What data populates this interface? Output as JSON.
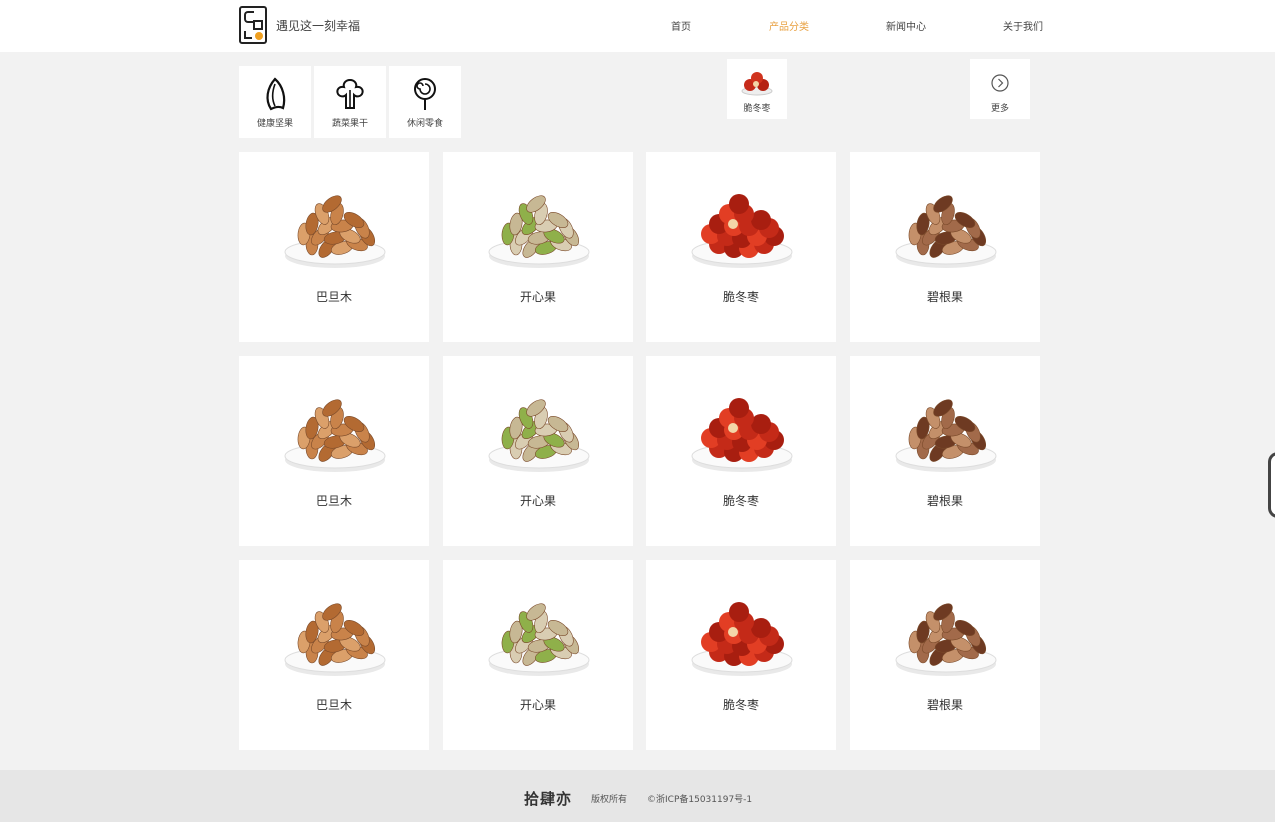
{
  "header": {
    "slogan": "遇见这一刻幸福",
    "nav": [
      {
        "label": "首页",
        "active": false
      },
      {
        "label": "产品分类",
        "active": true
      },
      {
        "label": "新闻中心",
        "active": false
      },
      {
        "label": "关于我们",
        "active": false
      }
    ],
    "colors": {
      "accent": "#e8a040"
    }
  },
  "categories": [
    {
      "label": "健康坚果",
      "icon": "nut-icon"
    },
    {
      "label": "蔬菜果干",
      "icon": "vegetable-icon"
    },
    {
      "label": "休闲零食",
      "icon": "lollipop-icon"
    }
  ],
  "featured_category": {
    "label": "脆冬枣",
    "icon": "jujube-icon"
  },
  "more": {
    "label": "更多",
    "icon": "chevron-right-circle-icon"
  },
  "products": [
    {
      "name": "巴旦木",
      "kind": "almond"
    },
    {
      "name": "开心果",
      "kind": "pistachio"
    },
    {
      "name": "脆冬枣",
      "kind": "jujube"
    },
    {
      "name": "碧根果",
      "kind": "pecan"
    },
    {
      "name": "巴旦木",
      "kind": "almond"
    },
    {
      "name": "开心果",
      "kind": "pistachio"
    },
    {
      "name": "脆冬枣",
      "kind": "jujube"
    },
    {
      "name": "碧根果",
      "kind": "pecan"
    },
    {
      "name": "巴旦木",
      "kind": "almond"
    },
    {
      "name": "开心果",
      "kind": "pistachio"
    },
    {
      "name": "脆冬枣",
      "kind": "jujube"
    },
    {
      "name": "碧根果",
      "kind": "pecan"
    }
  ],
  "footer": {
    "brand": "拾肆亦",
    "rights": "版权所有",
    "icp": "©浙ICP备15031197号-1"
  }
}
